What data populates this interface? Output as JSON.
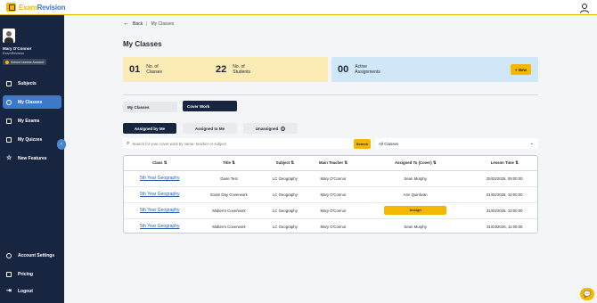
{
  "brand": {
    "name_part1": "Exam",
    "name_part2": "Revision"
  },
  "user": {
    "name": "Mary O'Connor",
    "org": "ExamRevision",
    "license": "School License Account"
  },
  "sidebar": {
    "items": [
      {
        "label": "Subjects"
      },
      {
        "label": "My Classes"
      },
      {
        "label": "My Exams"
      },
      {
        "label": "My Quizzes"
      },
      {
        "label": "New Features"
      }
    ],
    "bottom": [
      {
        "label": "Account Settings"
      },
      {
        "label": "Pricing"
      },
      {
        "label": "Logout"
      }
    ]
  },
  "breadcrumb": {
    "back": "Back",
    "current": "My Classes"
  },
  "page": {
    "title": "My Classes"
  },
  "stats": {
    "classes": {
      "value": "01",
      "label1": "No. of",
      "label2": "Classes"
    },
    "students": {
      "value": "22",
      "label1": "No. of",
      "label2": "Students"
    },
    "assignments": {
      "value": "00",
      "label1": "Active",
      "label2": "Assignments"
    },
    "new_button": "+ New"
  },
  "tabs": {
    "my_classes": "My Classes",
    "cover_work": "Cover Work"
  },
  "subtabs": {
    "assigned_by": "Assigned by Me",
    "assigned_to": "Assigned to Me",
    "unassigned": "Unassigned"
  },
  "search": {
    "placeholder": "Search for your cover work by name, teacher or subject",
    "button": "Search"
  },
  "filter": {
    "selected": "All Classes"
  },
  "table": {
    "headers": [
      "Class ⇅",
      "Title ⇅",
      "Subject ⇅",
      "Main Teacher ⇅",
      "Assigned To (Cover) ⇅",
      "Lesson Time ⇅"
    ],
    "rows": [
      {
        "class": "5th Year Geography",
        "title": "Daire Test",
        "subject": "LC Geography",
        "teacher": "Mary O'Connor",
        "assigned": "Sean Murphy",
        "time": "25/03/2026, 09:00:00"
      },
      {
        "class": "5th Year Geography",
        "title": "Exam Day Coverwork",
        "subject": "LC Geography",
        "teacher": "Mary O'Connor",
        "assigned": "Ann Quinlivan",
        "time": "01/04/2026, 10:00:00"
      },
      {
        "class": "5th Year Geography",
        "title": "Midterm Coverwork",
        "subject": "LC Geography",
        "teacher": "Mary O'Connor",
        "assigned": "Assign",
        "time": "31/03/2026, 10:00:00"
      },
      {
        "class": "5th Year Geography",
        "title": "Midterm Coverwork",
        "subject": "LC Geography",
        "teacher": "Mary O'Connor",
        "assigned": "Sean Murphy",
        "time": "31/03/2026, 11:00:00"
      }
    ]
  },
  "colors": {
    "accent": "#f5b800",
    "sidebar": "#172540",
    "active_nav": "#3d78c9"
  }
}
